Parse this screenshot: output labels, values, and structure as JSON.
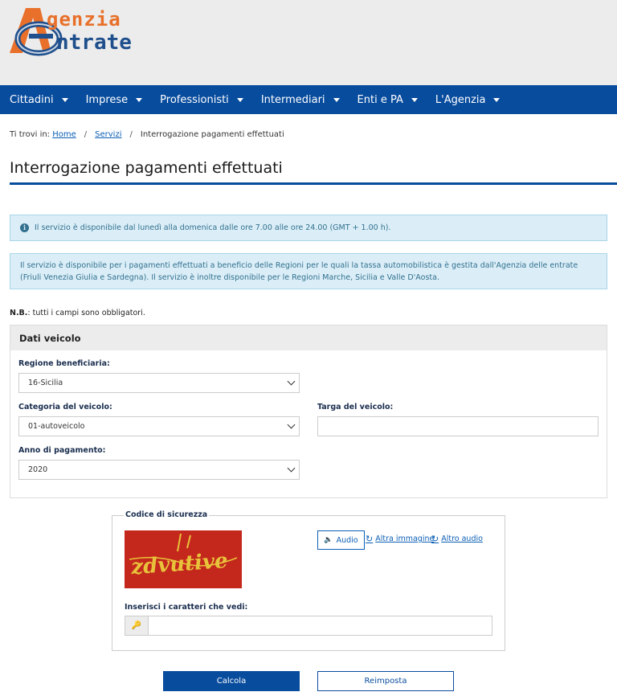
{
  "logo": {
    "line1": "genzia",
    "line2": "ntrate"
  },
  "nav": {
    "items": [
      {
        "label": "Cittadini"
      },
      {
        "label": "Imprese"
      },
      {
        "label": "Professionisti"
      },
      {
        "label": "Intermediari"
      },
      {
        "label": "Enti e PA"
      },
      {
        "label": "L'Agenzia"
      }
    ]
  },
  "breadcrumb": {
    "prefix": "Ti trovi in:",
    "items": [
      {
        "label": "Home"
      },
      {
        "label": "Servizi"
      }
    ],
    "current": "Interrogazione pagamenti effettuati",
    "separator": "/"
  },
  "page": {
    "title": "Interrogazione pagamenti effettuati"
  },
  "alerts": {
    "availability": "Il servizio è disponibile dal lunedì alla domenica dalle ore 7.00 alle ore 24.00 (GMT + 1.00 h).",
    "regions": "Il servizio è disponibile per i pagamenti effettuati a beneficio delle Regioni per le quali la tassa automobilistica è gestita dall'Agenzia delle entrate (Friuli Venezia Giulia e Sardegna). Il servizio è inoltre disponibile per le Regioni Marche, Sicilia e Valle D'Aosta."
  },
  "note": {
    "bold": "N.B.",
    "text": ": tutti i campi sono obbligatori."
  },
  "vehicle_panel": {
    "title": "Dati veicolo",
    "regione": {
      "label": "Regione beneficiaria:",
      "value": "16-Sicilia"
    },
    "categoria": {
      "label": "Categoria del veicolo:",
      "value": "01-autoveicolo"
    },
    "targa": {
      "label": "Targa del veicolo:",
      "value": ""
    },
    "anno": {
      "label": "Anno di pagamento:",
      "value": "2020"
    }
  },
  "captcha": {
    "legend": "Codice di sicurezza",
    "image_text": "zdvutive",
    "audio_label": "Audio",
    "other_image_label": "Altra immagine",
    "other_audio_label": "Altro audio",
    "input_label": "Inserisci i caratteri che vedi:",
    "input_value": ""
  },
  "actions": {
    "submit_label": "Calcola",
    "reset_label": "Reimposta"
  },
  "colors": {
    "brand_blue": "#084c9e",
    "logo_orange": "#e8702a",
    "alert_bg": "#dbeef7",
    "captcha_bg": "#c4281c",
    "captcha_text": "#e8c23a"
  }
}
